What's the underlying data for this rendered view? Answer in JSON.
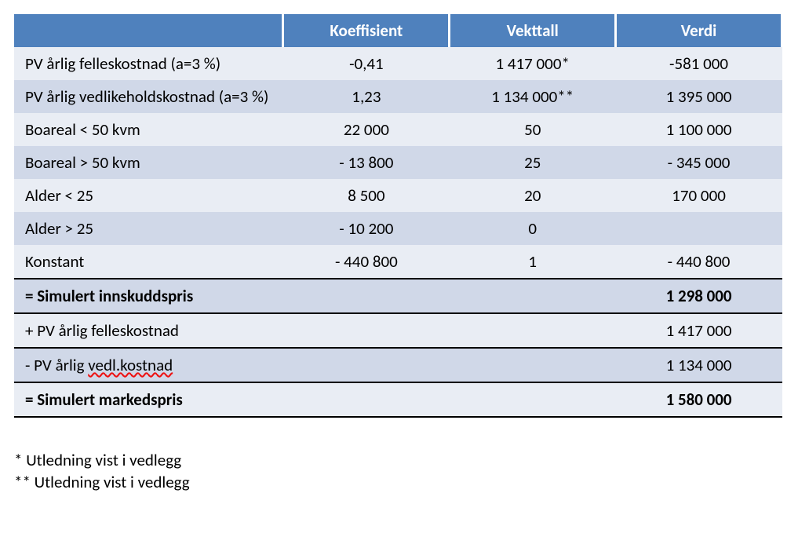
{
  "chart_data": {
    "type": "table",
    "columns": [
      "",
      "Koeffisient",
      "Vekttall",
      "Verdi"
    ],
    "rows": [
      {
        "label": "PV årlig felleskostnad (a=3 %)",
        "koeffisient": "-0,41",
        "vekttall": "1 417 000*",
        "verdi": "-581 000"
      },
      {
        "label": "PV årlig vedlikeholdskostnad (a=3 %)",
        "koeffisient": "1,23",
        "vekttall": "1 134 000**",
        "verdi": "1 395 000"
      },
      {
        "label": "Boareal < 50 kvm",
        "koeffisient": "22 000",
        "vekttall": "50",
        "verdi": "1 100 000"
      },
      {
        "label": "Boareal > 50 kvm",
        "koeffisient": "- 13 800",
        "vekttall": "25",
        "verdi": "- 345 000"
      },
      {
        "label": "Alder < 25",
        "koeffisient": "8 500",
        "vekttall": "20",
        "verdi": "170 000"
      },
      {
        "label": "Alder > 25",
        "koeffisient": "- 10 200",
        "vekttall": "0",
        "verdi": ""
      },
      {
        "label": "Konstant",
        "koeffisient": "- 440 800",
        "vekttall": "1",
        "verdi": "- 440 800"
      }
    ],
    "summary": [
      {
        "label": "= Simulert innskuddspris",
        "verdi": "1 298 000",
        "bold": true
      },
      {
        "label": "+ PV årlig felleskostnad",
        "verdi": "1 417 000"
      },
      {
        "label_pre": "- PV årlig ",
        "label_spell": "vedl.kostnad",
        "verdi": "1 134 000"
      },
      {
        "label": "= Simulert markedspris",
        "verdi": "1 580 000",
        "bold": true
      }
    ]
  },
  "headers": {
    "koeffisient": "Koeffisient",
    "vekttall": "Vekttall",
    "verdi": "Verdi"
  },
  "rows": {
    "r0": {
      "label": "PV årlig felleskostnad (a=3 %)",
      "k": "-0,41",
      "v": "1 417 000*",
      "val": "-581 000"
    },
    "r1": {
      "label": "PV årlig vedlikeholdskostnad (a=3 %)",
      "k": "1,23",
      "v": "1 134 000**",
      "val": "1 395 000"
    },
    "r2": {
      "label": "Boareal < 50 kvm",
      "k": "22 000",
      "v": "50",
      "val": "1 100 000"
    },
    "r3": {
      "label": "Boareal > 50 kvm",
      "k": "- 13 800",
      "v": "25",
      "val": "- 345 000"
    },
    "r4": {
      "label": "Alder < 25",
      "k": "8 500",
      "v": "20",
      "val": "170 000"
    },
    "r5": {
      "label": "Alder > 25",
      "k": "- 10 200",
      "v": "0",
      "val": ""
    },
    "r6": {
      "label": "Konstant",
      "k": "- 440 800",
      "v": "1",
      "val": "- 440 800"
    },
    "s0": {
      "label": "= Simulert innskuddspris",
      "val": "1 298 000"
    },
    "s1": {
      "label": "+ PV årlig felleskostnad",
      "val": "1 417 000"
    },
    "s2": {
      "label_pre": "- PV årlig ",
      "label_spell": "vedl.kostnad",
      "val": "1 134 000"
    },
    "s3": {
      "label": "= Simulert markedspris",
      "val": "1 580 000"
    }
  },
  "footnotes": {
    "f1": "*   Utledning vist i vedlegg",
    "f2": "** Utledning vist i vedlegg"
  }
}
